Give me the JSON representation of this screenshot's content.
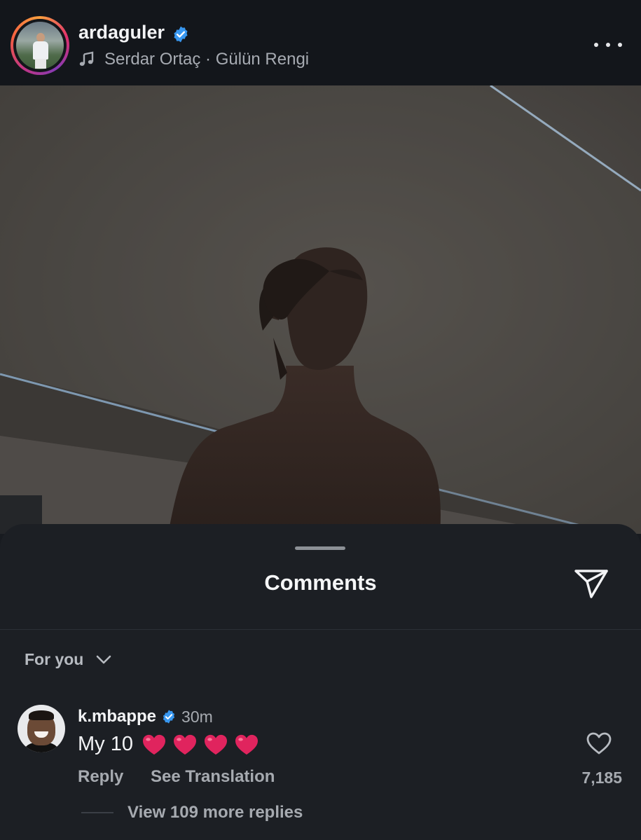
{
  "post_header": {
    "username": "ardaguler",
    "verified": true,
    "music_artist": "Serdar Ortaç",
    "music_separator": " · ",
    "music_title": "Gülün Rengi"
  },
  "comments_sheet": {
    "title": "Comments",
    "filter_label": "For you",
    "comments": [
      {
        "username": "k.mbappe",
        "verified": true,
        "time": "30m",
        "text": "My 10",
        "emoji_count": 4,
        "reply_label": "Reply",
        "translate_label": "See Translation",
        "like_count": "7,185",
        "view_replies_label": "View 109 more replies"
      }
    ]
  },
  "colors": {
    "background": "#181b20",
    "verified_blue": "#3897f0",
    "heart_red": "#e0245e"
  }
}
